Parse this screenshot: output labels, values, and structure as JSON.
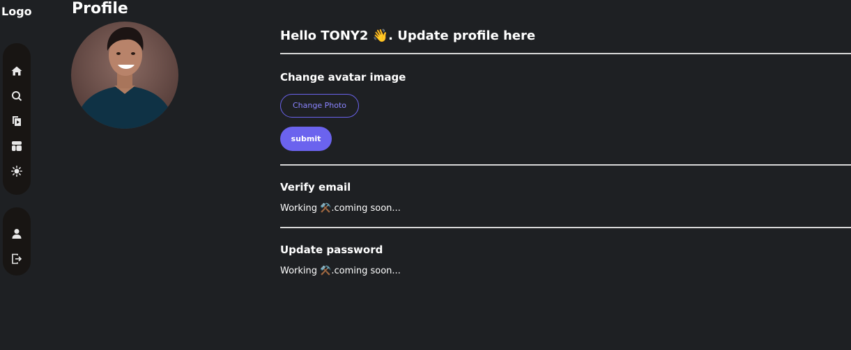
{
  "sidebar": {
    "logo": "Logo",
    "top_items": [
      {
        "icon": "home-icon"
      },
      {
        "icon": "search-icon"
      },
      {
        "icon": "video-library-icon"
      },
      {
        "icon": "layout-icon"
      },
      {
        "icon": "sun-icon"
      }
    ],
    "bottom_items": [
      {
        "icon": "user-icon"
      },
      {
        "icon": "logout-icon"
      }
    ]
  },
  "profile": {
    "title": "Profile"
  },
  "main": {
    "greeting": "Hello TONY2 👋. Update profile here",
    "avatar_section": {
      "title": "Change avatar image",
      "change_photo_label": "Change Photo",
      "submit_label": "submit"
    },
    "verify_email": {
      "title": "Verify email",
      "status": "Working ⚒️.coming soon..."
    },
    "update_password": {
      "title": "Update password",
      "status": "Working ⚒️.coming soon..."
    }
  },
  "colors": {
    "background": "#1e2023",
    "sidebar": "#181513",
    "accent": "#6b63ee"
  }
}
